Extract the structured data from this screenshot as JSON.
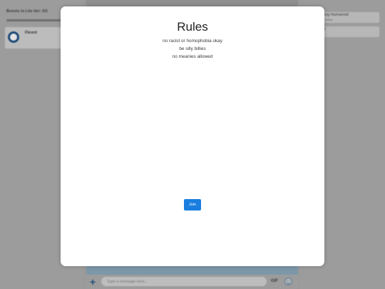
{
  "background": {
    "boost_label": "Boosts to Lite tier: 0/2",
    "server_name": "Flicord",
    "members": [
      {
        "name": "ing Humanoid",
        "sub": "Online"
      },
      {
        "name": "t",
        "sub": ""
      }
    ],
    "composer": {
      "placeholder": "Type a message here...",
      "gif_label": "GIF"
    }
  },
  "modal": {
    "title": "Rules",
    "rules": [
      "no racist or homophobia okay",
      "be silly billies",
      "no meanies allowed"
    ],
    "join_label": "Join"
  },
  "colors": {
    "accent": "#1a7ee0",
    "modal_bg": "#ffffff"
  }
}
